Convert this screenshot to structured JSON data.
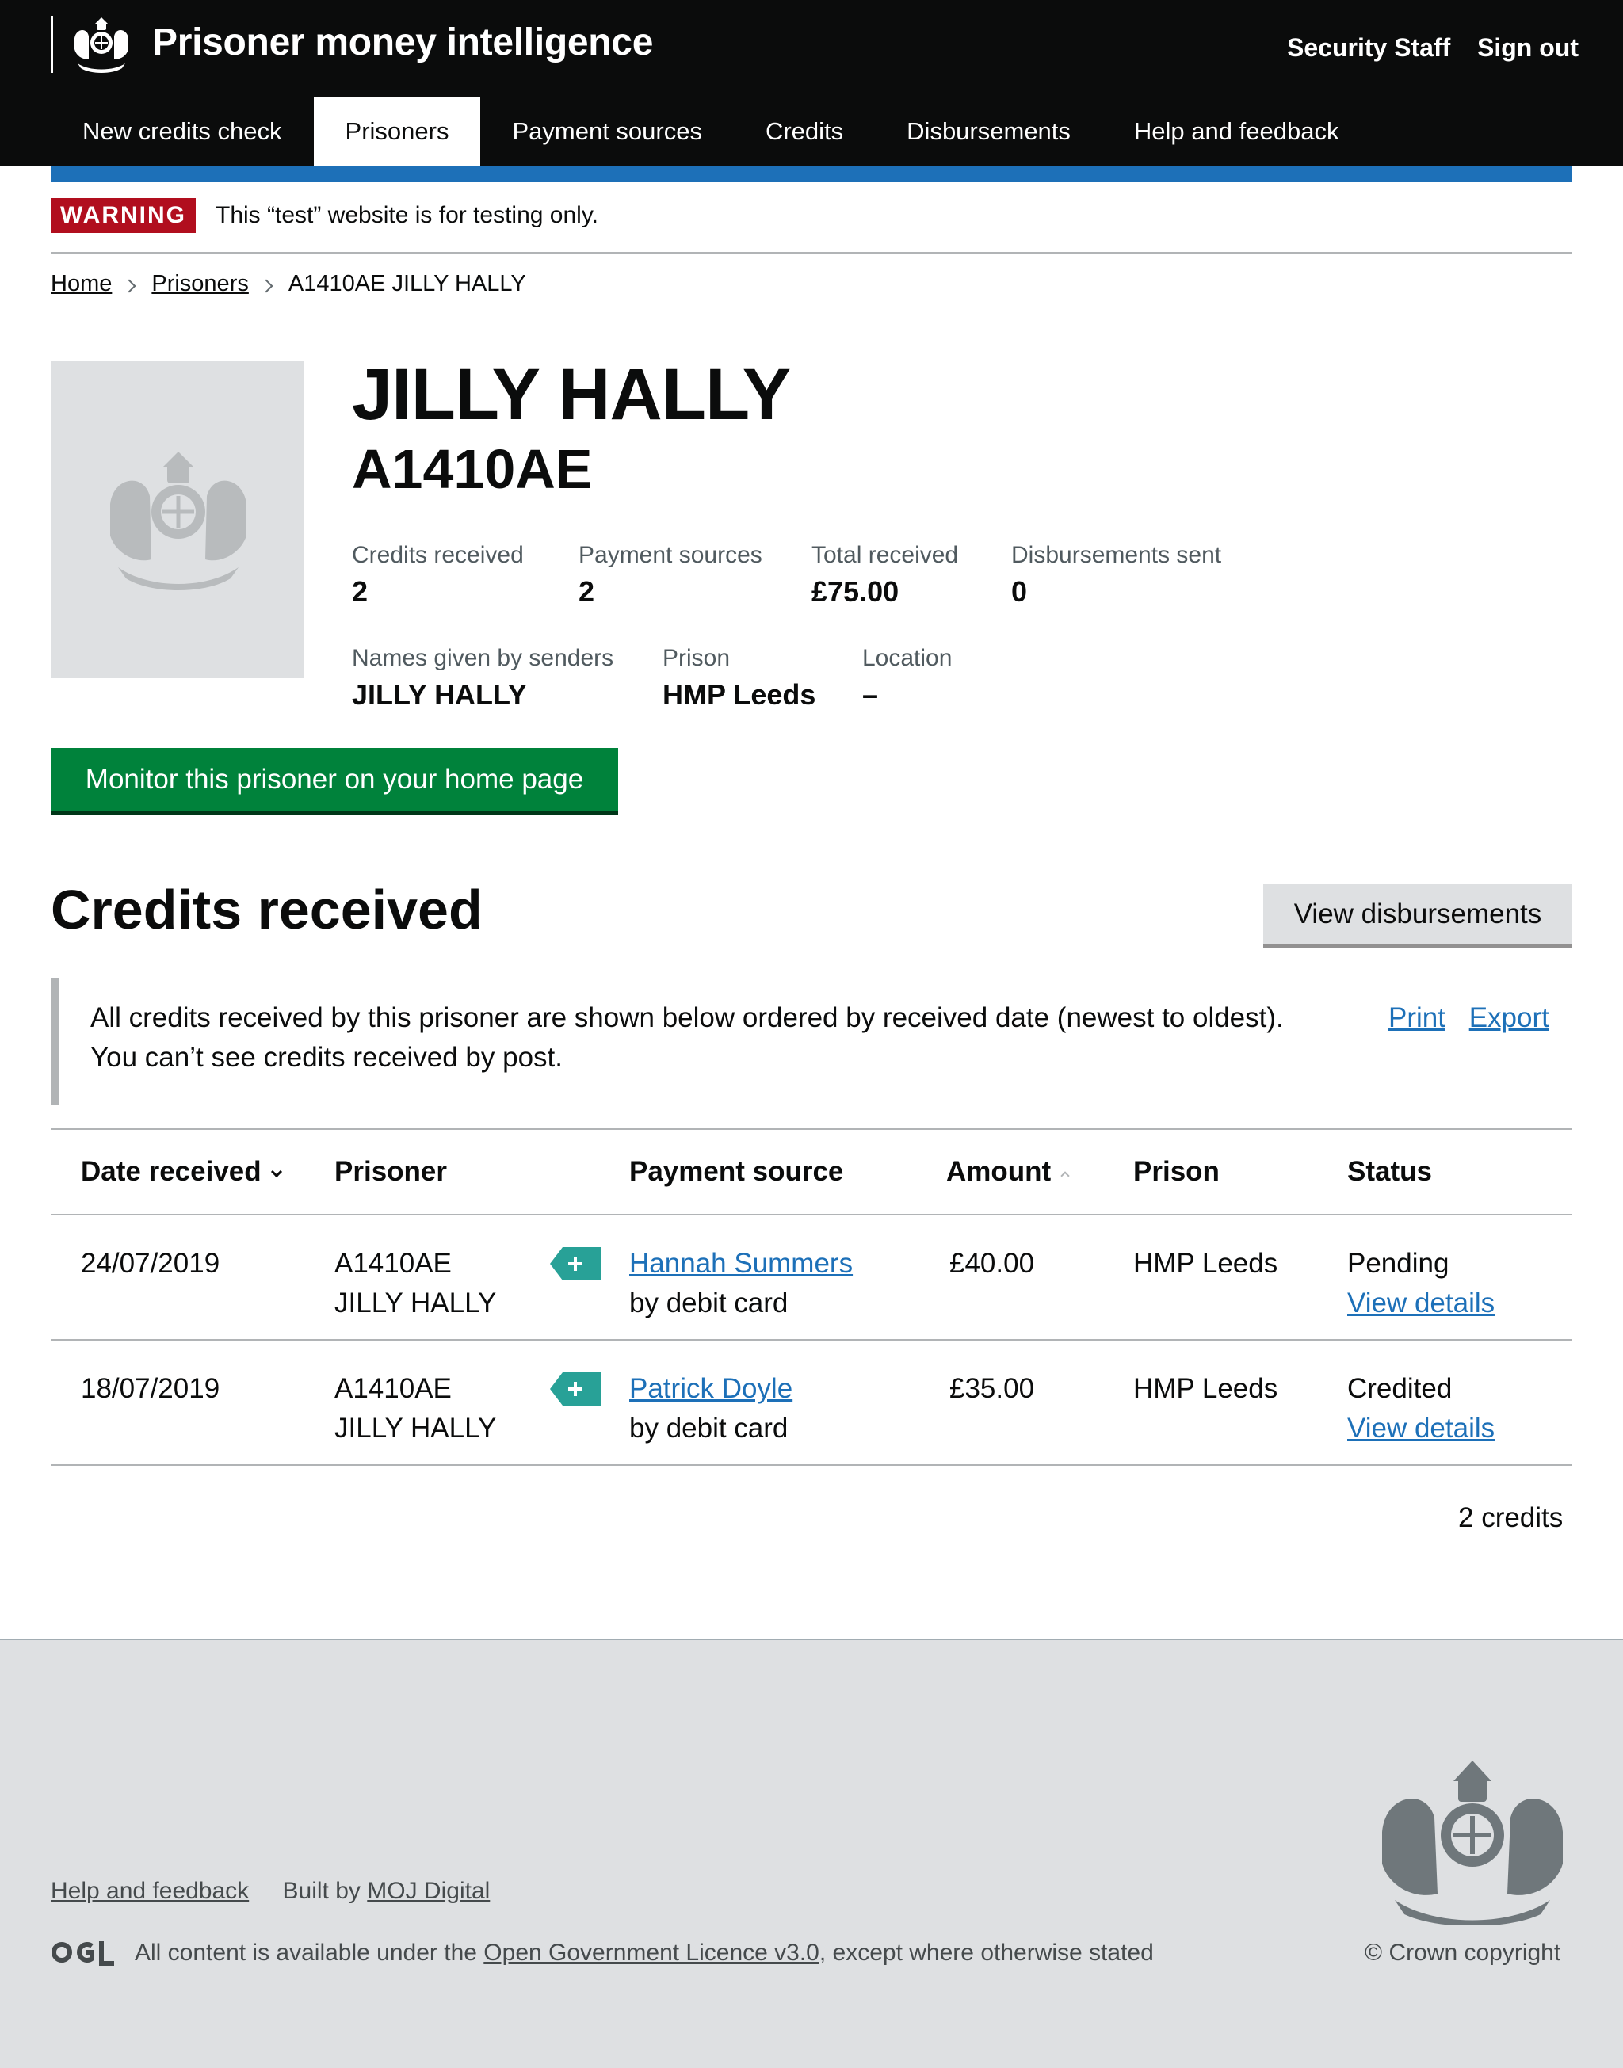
{
  "header": {
    "service_name": "Prisoner money intelligence",
    "user_name": "Security Staff",
    "sign_out": "Sign out"
  },
  "nav": {
    "items": [
      {
        "label": "New credits check",
        "active": false
      },
      {
        "label": "Prisoners",
        "active": true
      },
      {
        "label": "Payment sources",
        "active": false
      },
      {
        "label": "Credits",
        "active": false
      },
      {
        "label": "Disbursements",
        "active": false
      },
      {
        "label": "Help and feedback",
        "active": false
      }
    ]
  },
  "warning": {
    "tag": "WARNING",
    "text": "This “test” website is for testing only."
  },
  "breadcrumb": {
    "home": "Home",
    "prisoners": "Prisoners",
    "current": "A1410AE JILLY HALLY"
  },
  "prisoner": {
    "name": "JILLY HALLY",
    "number": "A1410AE",
    "stats": {
      "credits_received": {
        "label": "Credits received",
        "value": "2"
      },
      "payment_sources": {
        "label": "Payment sources",
        "value": "2"
      },
      "total_received": {
        "label": "Total received",
        "value": "£75.00"
      },
      "disbursements_sent": {
        "label": "Disbursements sent",
        "value": "0"
      },
      "names_given": {
        "label": "Names given by senders",
        "value": "JILLY HALLY"
      },
      "prison": {
        "label": "Prison",
        "value": "HMP Leeds"
      },
      "location": {
        "label": "Location",
        "value": "–"
      }
    },
    "monitor_button": "Monitor this prisoner on your home page"
  },
  "credits": {
    "title": "Credits received",
    "view_disbursements": "View disbursements",
    "info": "All credits received by this prisoner are shown below ordered by received date (newest to oldest). You can’t see credits received by post.",
    "print": "Print",
    "export": "Export",
    "columns": {
      "date": "Date received",
      "prisoner": "Prisoner",
      "source": "Payment source",
      "amount": "Amount",
      "prison": "Prison",
      "status": "Status"
    },
    "rows": [
      {
        "date": "24/07/2019",
        "prisoner_number": "A1410AE",
        "prisoner_name": "JILLY HALLY",
        "source_name": "Hannah Summers",
        "source_method": "by debit card",
        "amount": "£40.00",
        "prison": "HMP Leeds",
        "status": "Pending",
        "details": "View details"
      },
      {
        "date": "18/07/2019",
        "prisoner_number": "A1410AE",
        "prisoner_name": "JILLY HALLY",
        "source_name": "Patrick Doyle",
        "source_method": "by debit card",
        "amount": "£35.00",
        "prison": "HMP Leeds",
        "status": "Credited",
        "details": "View details"
      }
    ],
    "count": "2 credits"
  },
  "footer": {
    "help": "Help and feedback",
    "built_by": "Built by",
    "moj": "MOJ Digital",
    "ogl": "OGL",
    "licence_prefix": "All content is available under the",
    "licence_link": "Open Government Licence v3.0",
    "licence_suffix": ", except where otherwise stated",
    "copyright": "© Crown copyright"
  },
  "colors": {
    "header_bg": "#0b0c0c",
    "stripe": "#1d70b8",
    "warning": "#b10e1e",
    "button_green": "#00823b",
    "tag_teal": "#28a197",
    "footer_bg": "#dee0e2"
  }
}
